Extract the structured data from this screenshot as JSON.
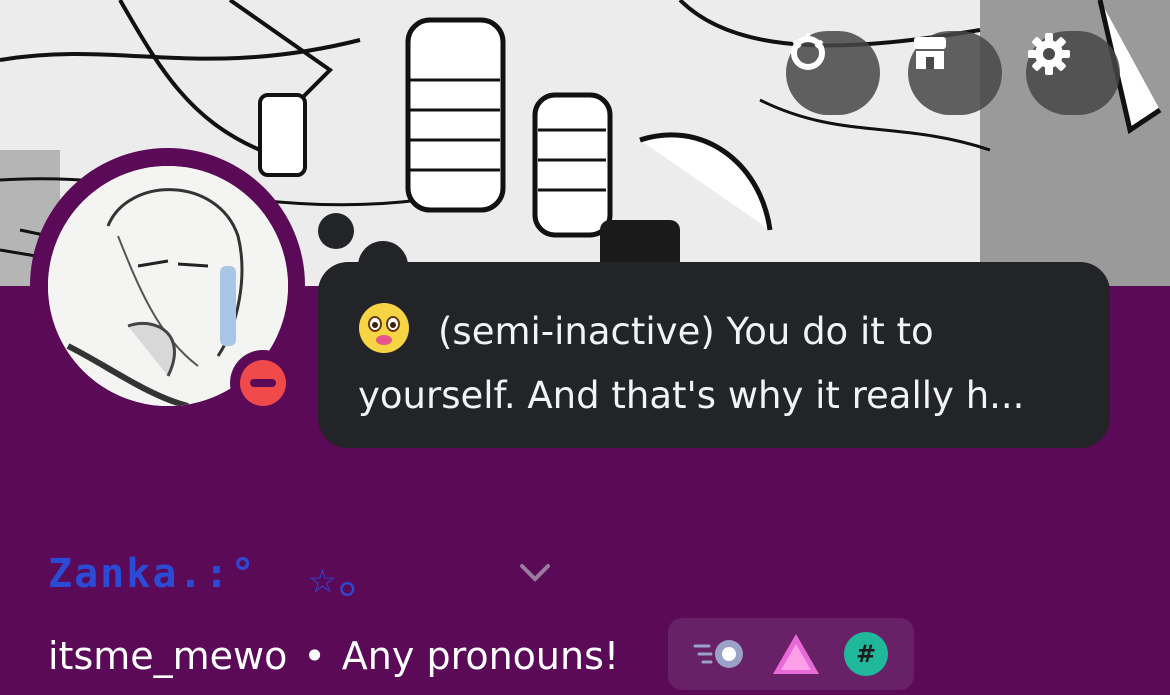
{
  "banner": {
    "buttons": [
      {
        "name": "nitro-badge-button",
        "icon": "laurel-badge-icon"
      },
      {
        "name": "shop-button",
        "icon": "shop-icon"
      },
      {
        "name": "settings-button",
        "icon": "gear-icon"
      }
    ]
  },
  "profile": {
    "status": "do-not-disturb",
    "custom_status": {
      "emoji": "blushing-face-emoji",
      "text_line1": "(semi-inactive) You do it to",
      "text_line2": "yourself. And that's why it really h..."
    },
    "display_name": "Zanka.:°",
    "display_name_suffix": "☆。",
    "username": "itsme_mewo",
    "separator": "•",
    "pronouns": "Any pronouns!",
    "badges": [
      "nitro-speed-badge-icon",
      "hypesquad-triangle-badge-icon",
      "hashtag-badge-icon"
    ]
  },
  "colors": {
    "background": "#5a0a57",
    "bubble": "#232428",
    "name": "#2b4bd6",
    "dnd": "#f0494a"
  }
}
